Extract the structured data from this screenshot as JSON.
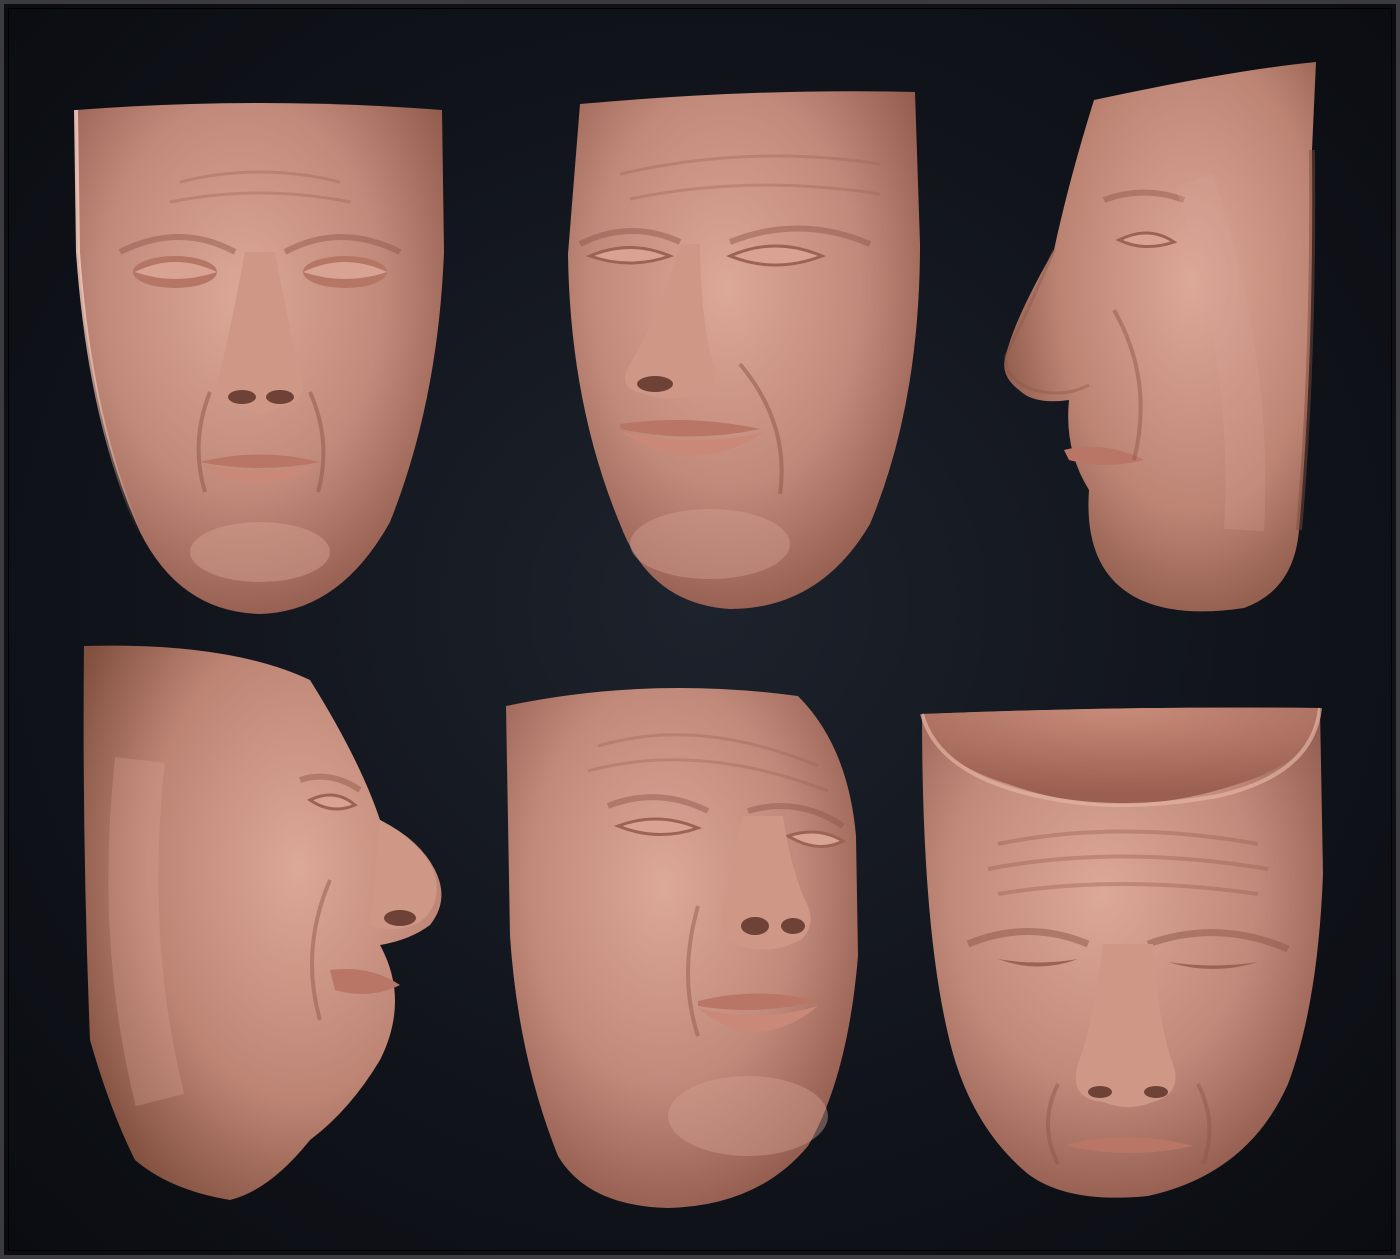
{
  "scene": {
    "subject": "sculpted-face-mask",
    "view_count": 6,
    "colors": {
      "background_center": "#1d222c",
      "background_edge": "#0a0c11",
      "border": "#3c3c40",
      "skin_light": "#d9a596",
      "skin_mid": "#b97d6c",
      "skin_shadow": "#6e4237",
      "rim_light": "#f3c9ba"
    },
    "views": [
      {
        "id": "front"
      },
      {
        "id": "three-quarter-left"
      },
      {
        "id": "profile-left"
      },
      {
        "id": "profile-right-tilted"
      },
      {
        "id": "low-angle-three-quarter"
      },
      {
        "id": "top-down"
      }
    ]
  }
}
